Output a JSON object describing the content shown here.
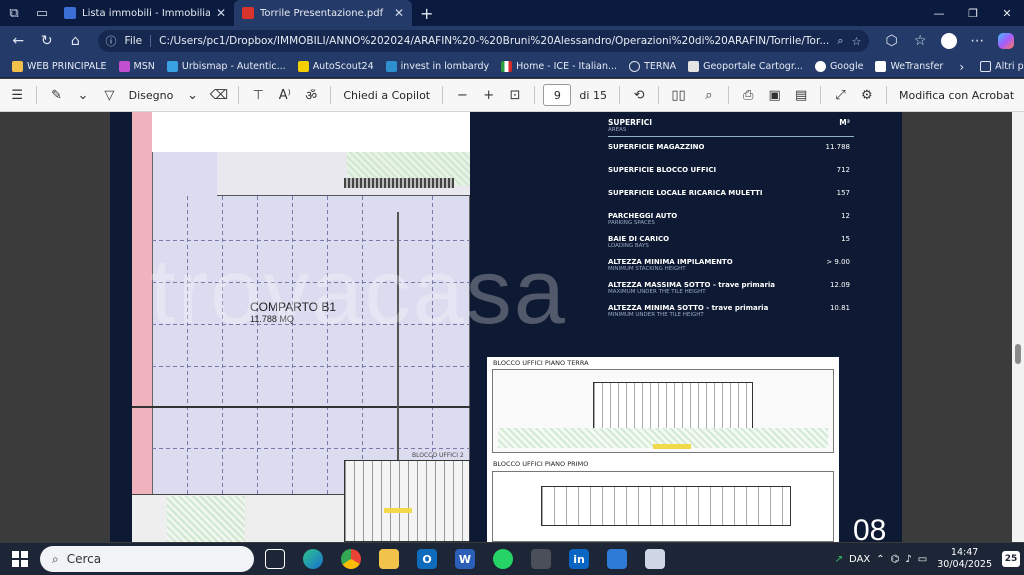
{
  "browser": {
    "tabs": [
      {
        "label": "Lista immobili - ImmobiliarePro",
        "close": "✕"
      },
      {
        "label": "Torrile Presentazione.pdf",
        "close": "✕"
      }
    ],
    "new_tab": "+",
    "url_chip": "File",
    "url": "C:/Users/pc1/Dropbox/IMMOBILI/ANNO%202024/ARAFIN%20-%20Bruni%20Alessandro/Operazioni%20di%20ARAFIN/Torrile/Tor..."
  },
  "bookmarks": [
    "WEB PRINCIPALE",
    "MSN",
    "Urbismap - Autentic...",
    "AutoScout24",
    "invest in lombardy",
    "Home - ICE - Italian...",
    "TERNA",
    "Geoportale Cartogr...",
    "Google",
    "WeTransfer"
  ],
  "bookmarks_other": "Altri preferiti",
  "pdf_toolbar": {
    "draw_label": "Disegno",
    "copilot_label": "Chiedi a Copilot",
    "page_current": "9",
    "page_total": "di 15",
    "edit_label": "Modifica con Acrobat"
  },
  "pdf_page": {
    "plan": {
      "room_name": "COMPARTO B1",
      "room_area": "11.788 MQ",
      "office_tag": "BLOCCO UFFICI 2"
    },
    "specs": {
      "header_title": "SUPERFICI",
      "header_sub": "AREAS",
      "unit": "M²",
      "rows": [
        {
          "label": "SUPERFICIE MAGAZZINO",
          "sub": "",
          "value": "11.788"
        },
        {
          "label": "SUPERFICIE BLOCCO UFFICI",
          "sub": "",
          "value": "712"
        },
        {
          "label": "SUPERFICIE LOCALE RICARICA MULETTI",
          "sub": "",
          "value": "157"
        },
        {
          "label": "PARCHEGGI AUTO",
          "sub": "PARKING SPACES",
          "value": "12"
        },
        {
          "label": "BAIE DI CARICO",
          "sub": "LOADING BAYS",
          "value": "15"
        },
        {
          "label": "ALTEZZA MINIMA IMPILAMENTO",
          "sub": "MINIMUM STACKING HEIGHT",
          "value": "> 9.00"
        },
        {
          "label": "ALTEZZA MASSIMA SOTTO - trave primaria",
          "sub": "MAXIMUM UNDER THE TILE HEIGHT",
          "value": "12.09"
        },
        {
          "label": "ALTEZZA MINIMA SOTTO - trave primaria",
          "sub": "MINIMUM UNDER THE TILE HEIGHT",
          "value": "10.81"
        }
      ]
    },
    "office_plans": {
      "ground_title": "BLOCCO UFFICI  PIANO TERRA",
      "first_title": "BLOCCO UFFICI  PIANO PRIMO"
    },
    "page_number": "08",
    "watermark": "trovacasa"
  },
  "taskbar": {
    "search_placeholder": "Cerca",
    "tray_label": "DAX",
    "time": "14:47",
    "date": "30/04/2025",
    "notifications": "25"
  },
  "colors": {
    "page_bg": "#0e1a33",
    "browser_dark": "#0b1b3f",
    "browser_bar": "#243a68",
    "plan_hall": "#dcdcf0",
    "pink_strip": "#f0b3bd"
  }
}
